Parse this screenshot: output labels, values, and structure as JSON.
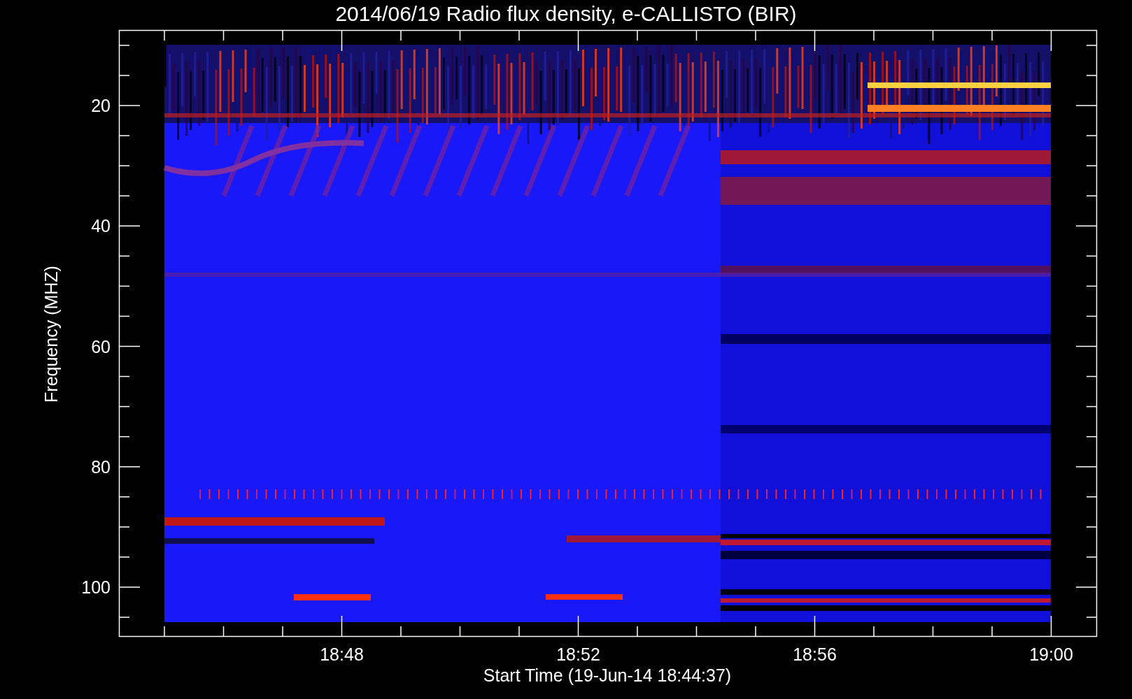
{
  "title": "2014/06/19  Radio flux density, e-CALLISTO (BIR)",
  "y_axis": {
    "label": "Frequency (MHZ)",
    "ticks": [
      "20",
      "40",
      "60",
      "80",
      "100"
    ]
  },
  "x_axis": {
    "label": "Start Time (19-Jun-14 18:44:37)",
    "ticks": [
      "18:48",
      "18:52",
      "18:56",
      "19:00"
    ]
  }
}
